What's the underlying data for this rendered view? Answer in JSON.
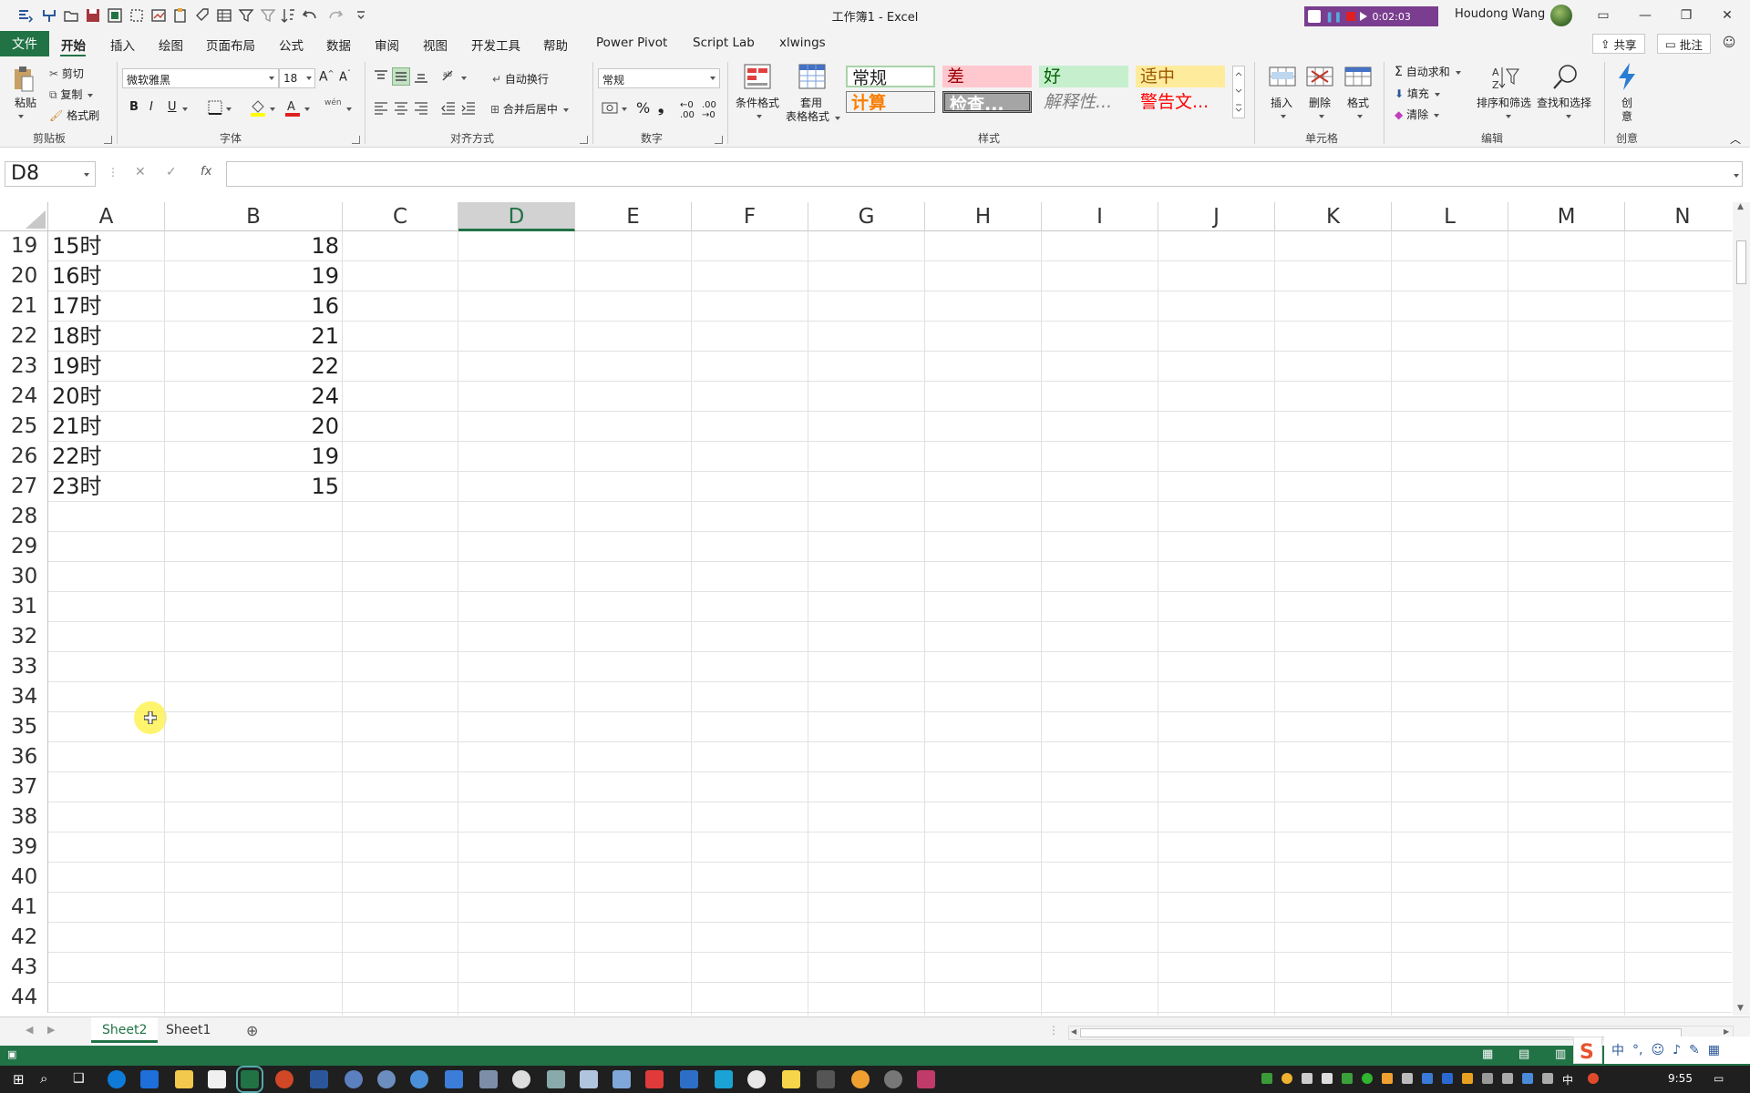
{
  "window": {
    "title": "工作簿1  -  Excel",
    "user": "Houdong Wang",
    "recorder_time": "0:02:03",
    "accent": "#217346"
  },
  "tabs": [
    "文件",
    "开始",
    "插入",
    "绘图",
    "页面布局",
    "公式",
    "数据",
    "审阅",
    "视图",
    "开发工具",
    "帮助",
    "Power Pivot",
    "Script Lab",
    "xlwings"
  ],
  "active_tab": "开始",
  "share_label": "共享",
  "comment_label": "批注",
  "ribbon": {
    "clipboard": {
      "paste": "粘贴",
      "cut": "剪切",
      "copy": "复制",
      "format_painter": "格式刷",
      "label": "剪贴板"
    },
    "font": {
      "name": "微软雅黑",
      "size": "18",
      "label": "字体",
      "bold": "B",
      "italic": "I",
      "underline": "U",
      "wen": "wén"
    },
    "alignment": {
      "wrap": "自动换行",
      "merge": "合并后居中",
      "label": "对齐方式"
    },
    "number": {
      "format": "常规",
      "label": "数字"
    },
    "styles": {
      "conditional": "条件格式",
      "table_format_1": "套用",
      "table_format_2": "表格格式",
      "cells": [
        "常规",
        "差",
        "好",
        "适中",
        "计算",
        "检查...",
        "解释性...",
        "警告文..."
      ],
      "label": "样式"
    },
    "cells": {
      "insert": "插入",
      "delete": "删除",
      "format": "格式",
      "label": "单元格"
    },
    "editing": {
      "autosum": "自动求和",
      "fill": "填充",
      "clear": "清除",
      "sort": "排序和筛选",
      "find": "查找和选择",
      "label": "编辑"
    },
    "creativity": {
      "btn_1": "创",
      "btn_2": "意",
      "label": "创意"
    }
  },
  "namebox": "D8",
  "formula_fx": "fx",
  "columns": [
    "A",
    "B",
    "C",
    "D",
    "E",
    "F",
    "G",
    "H",
    "I",
    "J",
    "K",
    "L",
    "M",
    "N"
  ],
  "selected_column": "D",
  "rows": [
    {
      "n": "19",
      "a": "15时",
      "b": "18"
    },
    {
      "n": "20",
      "a": "16时",
      "b": "19"
    },
    {
      "n": "21",
      "a": "17时",
      "b": "16"
    },
    {
      "n": "22",
      "a": "18时",
      "b": "21"
    },
    {
      "n": "23",
      "a": "19时",
      "b": "22"
    },
    {
      "n": "24",
      "a": "20时",
      "b": "24"
    },
    {
      "n": "25",
      "a": "21时",
      "b": "20"
    },
    {
      "n": "26",
      "a": "22时",
      "b": "19"
    },
    {
      "n": "27",
      "a": "23时",
      "b": "15"
    },
    {
      "n": "28",
      "a": "",
      "b": ""
    },
    {
      "n": "29",
      "a": "",
      "b": ""
    },
    {
      "n": "30",
      "a": "",
      "b": ""
    },
    {
      "n": "31",
      "a": "",
      "b": ""
    },
    {
      "n": "32",
      "a": "",
      "b": ""
    },
    {
      "n": "33",
      "a": "",
      "b": ""
    },
    {
      "n": "34",
      "a": "",
      "b": ""
    },
    {
      "n": "35",
      "a": "",
      "b": ""
    },
    {
      "n": "36",
      "a": "",
      "b": ""
    },
    {
      "n": "37",
      "a": "",
      "b": ""
    },
    {
      "n": "38",
      "a": "",
      "b": ""
    },
    {
      "n": "39",
      "a": "",
      "b": ""
    },
    {
      "n": "40",
      "a": "",
      "b": ""
    },
    {
      "n": "41",
      "a": "",
      "b": ""
    },
    {
      "n": "42",
      "a": "",
      "b": ""
    },
    {
      "n": "43",
      "a": "",
      "b": ""
    },
    {
      "n": "44",
      "a": "",
      "b": ""
    }
  ],
  "sheets": [
    "Sheet2",
    "Sheet1"
  ],
  "active_sheet": "Sheet2",
  "taskbar": {
    "time": "9:55",
    "ime_1": "中",
    "ime_2": "中"
  }
}
